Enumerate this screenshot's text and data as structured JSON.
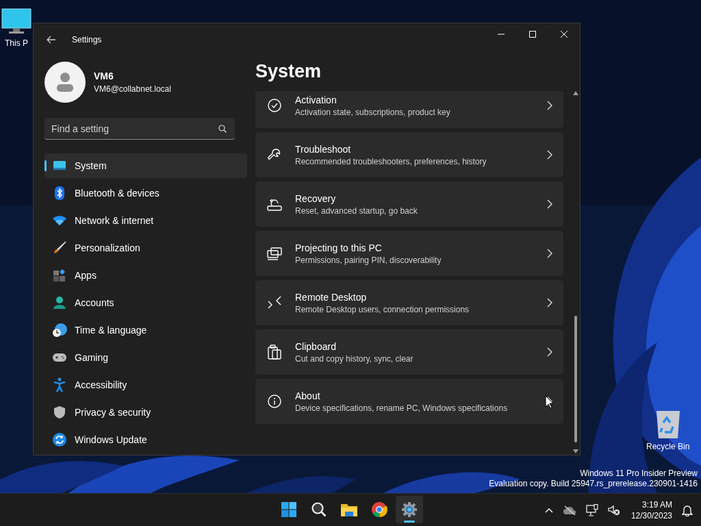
{
  "desktop": {
    "icons": [
      {
        "kind": "computer",
        "label": "This P"
      },
      {
        "kind": "recycle-bin",
        "label": "Recycle Bin"
      }
    ],
    "watermark": [
      "Windows 11 Pro Insider Preview",
      "Evaluation copy. Build 25947.rs_prerelease.230901-1416"
    ]
  },
  "window": {
    "title": "Settings",
    "user": {
      "name": "VM6",
      "email": "VM6@collabnet.local"
    },
    "search": {
      "placeholder": "Find a setting"
    },
    "nav": [
      {
        "kind": "system",
        "label": "System",
        "selected": true
      },
      {
        "kind": "bluetooth",
        "label": "Bluetooth & devices",
        "selected": false
      },
      {
        "kind": "network",
        "label": "Network & internet",
        "selected": false
      },
      {
        "kind": "personalization",
        "label": "Personalization",
        "selected": false
      },
      {
        "kind": "apps",
        "label": "Apps",
        "selected": false
      },
      {
        "kind": "accounts",
        "label": "Accounts",
        "selected": false
      },
      {
        "kind": "time",
        "label": "Time & language",
        "selected": false
      },
      {
        "kind": "gaming",
        "label": "Gaming",
        "selected": false
      },
      {
        "kind": "accessibility",
        "label": "Accessibility",
        "selected": false
      },
      {
        "kind": "privacy",
        "label": "Privacy & security",
        "selected": false
      },
      {
        "kind": "update",
        "label": "Windows Update",
        "selected": false
      }
    ],
    "page_title": "System",
    "cards": [
      {
        "kind": "activation",
        "title": "Activation",
        "subtitle": "Activation state, subscriptions, product key"
      },
      {
        "kind": "troubleshoot",
        "title": "Troubleshoot",
        "subtitle": "Recommended troubleshooters, preferences, history"
      },
      {
        "kind": "recovery",
        "title": "Recovery",
        "subtitle": "Reset, advanced startup, go back"
      },
      {
        "kind": "projecting",
        "title": "Projecting to this PC",
        "subtitle": "Permissions, pairing PIN, discoverability"
      },
      {
        "kind": "remote",
        "title": "Remote Desktop",
        "subtitle": "Remote Desktop users, connection permissions"
      },
      {
        "kind": "clipboard",
        "title": "Clipboard",
        "subtitle": "Cut and copy history, sync, clear"
      },
      {
        "kind": "about",
        "title": "About",
        "subtitle": "Device specifications, rename PC, Windows specifications"
      }
    ]
  },
  "taskbar": {
    "apps": [
      {
        "kind": "start",
        "selected": false
      },
      {
        "kind": "search",
        "selected": false
      },
      {
        "kind": "explorer",
        "selected": false
      },
      {
        "kind": "browser",
        "selected": false
      },
      {
        "kind": "settings",
        "selected": true
      }
    ],
    "clock": {
      "time": "3:19 AM",
      "date": "12/30/2023"
    }
  }
}
